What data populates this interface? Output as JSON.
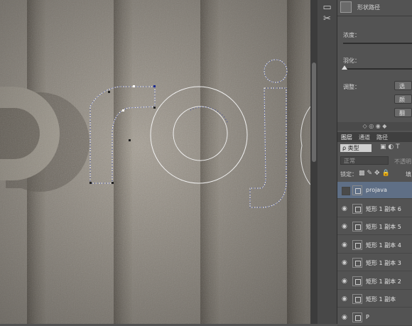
{
  "canvas": {
    "letters": "proj"
  },
  "panel": {
    "header_label": "形状路径",
    "density_label": "浓度：",
    "feather_label": "羽化：",
    "adjust_label": "调整：",
    "btn1": "选",
    "btn2": "颜",
    "btn3": "翻"
  },
  "layers_panel": {
    "tabs": [
      "图层",
      "通道",
      "路径"
    ],
    "filter_kind": "ρ 类型",
    "blend_mode": "正常",
    "opacity_label": "不透明",
    "lock_label": "锁定：",
    "fill_label": "填",
    "layers": [
      {
        "name": "projava",
        "selected": true
      },
      {
        "name": "矩形 1 副本 6",
        "selected": false
      },
      {
        "name": "矩形 1 副本 5",
        "selected": false
      },
      {
        "name": "矩形 1 副本 4",
        "selected": false
      },
      {
        "name": "矩形 1 副本 3",
        "selected": false
      },
      {
        "name": "矩形 1 副本 2",
        "selected": false
      },
      {
        "name": "矩形 1 副本",
        "selected": false
      },
      {
        "name": "P",
        "selected": false
      }
    ]
  },
  "colors": {
    "canvas_bg": "#a49d92",
    "stripe": "#7f776c",
    "selected_layer": "#5f6f86"
  }
}
